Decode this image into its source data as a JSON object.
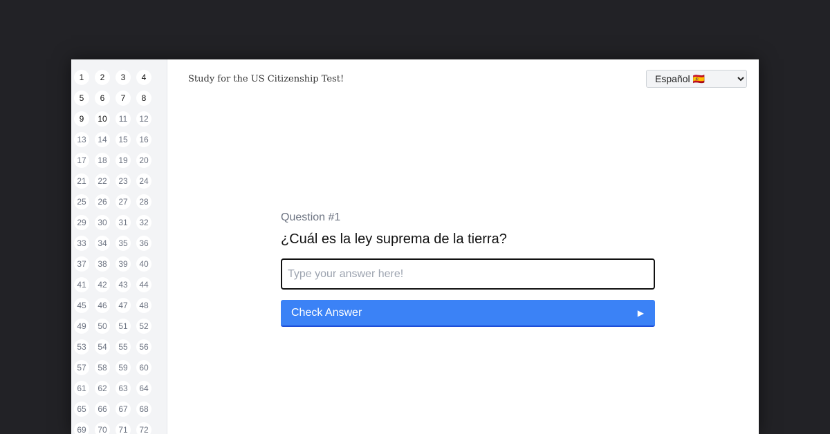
{
  "header": {
    "title": "Study for the US Citizenship Test!",
    "language_select": {
      "selected": "Español 🇪🇸",
      "options": [
        "Español 🇪🇸"
      ]
    }
  },
  "sidebar": {
    "questions": [
      {
        "label": "1",
        "done": true
      },
      {
        "label": "2",
        "done": true
      },
      {
        "label": "3",
        "done": true
      },
      {
        "label": "4",
        "done": true
      },
      {
        "label": "5",
        "done": true
      },
      {
        "label": "6",
        "done": true
      },
      {
        "label": "7",
        "done": true
      },
      {
        "label": "8",
        "done": true
      },
      {
        "label": "9",
        "done": true
      },
      {
        "label": "10",
        "done": true
      },
      {
        "label": "11",
        "done": false
      },
      {
        "label": "12",
        "done": false
      },
      {
        "label": "13",
        "done": false
      },
      {
        "label": "14",
        "done": false
      },
      {
        "label": "15",
        "done": false
      },
      {
        "label": "16",
        "done": false
      },
      {
        "label": "17",
        "done": false
      },
      {
        "label": "18",
        "done": false
      },
      {
        "label": "19",
        "done": false
      },
      {
        "label": "20",
        "done": false
      },
      {
        "label": "21",
        "done": false
      },
      {
        "label": "22",
        "done": false
      },
      {
        "label": "23",
        "done": false
      },
      {
        "label": "24",
        "done": false
      },
      {
        "label": "25",
        "done": false
      },
      {
        "label": "26",
        "done": false
      },
      {
        "label": "27",
        "done": false
      },
      {
        "label": "28",
        "done": false
      },
      {
        "label": "29",
        "done": false
      },
      {
        "label": "30",
        "done": false
      },
      {
        "label": "31",
        "done": false
      },
      {
        "label": "32",
        "done": false
      },
      {
        "label": "33",
        "done": false
      },
      {
        "label": "34",
        "done": false
      },
      {
        "label": "35",
        "done": false
      },
      {
        "label": "36",
        "done": false
      },
      {
        "label": "37",
        "done": false
      },
      {
        "label": "38",
        "done": false
      },
      {
        "label": "39",
        "done": false
      },
      {
        "label": "40",
        "done": false
      },
      {
        "label": "41",
        "done": false
      },
      {
        "label": "42",
        "done": false
      },
      {
        "label": "43",
        "done": false
      },
      {
        "label": "44",
        "done": false
      },
      {
        "label": "45",
        "done": false
      },
      {
        "label": "46",
        "done": false
      },
      {
        "label": "47",
        "done": false
      },
      {
        "label": "48",
        "done": false
      },
      {
        "label": "49",
        "done": false
      },
      {
        "label": "50",
        "done": false
      },
      {
        "label": "51",
        "done": false
      },
      {
        "label": "52",
        "done": false
      },
      {
        "label": "53",
        "done": false
      },
      {
        "label": "54",
        "done": false
      },
      {
        "label": "55",
        "done": false
      },
      {
        "label": "56",
        "done": false
      },
      {
        "label": "57",
        "done": false
      },
      {
        "label": "58",
        "done": false
      },
      {
        "label": "59",
        "done": false
      },
      {
        "label": "60",
        "done": false
      },
      {
        "label": "61",
        "done": false
      },
      {
        "label": "62",
        "done": false
      },
      {
        "label": "63",
        "done": false
      },
      {
        "label": "64",
        "done": false
      },
      {
        "label": "65",
        "done": false
      },
      {
        "label": "66",
        "done": false
      },
      {
        "label": "67",
        "done": false
      },
      {
        "label": "68",
        "done": false
      },
      {
        "label": "69",
        "done": false
      },
      {
        "label": "70",
        "done": false
      },
      {
        "label": "71",
        "done": false
      },
      {
        "label": "72",
        "done": false
      }
    ]
  },
  "question": {
    "number_label": "Question #1",
    "text": "¿Cuál es la ley suprema de la tierra?",
    "answer_value": "",
    "answer_placeholder": "Type your answer here!",
    "check_label": "Check Answer",
    "check_icon": "play-icon"
  },
  "colors": {
    "background": "#222226",
    "sidebar": "#f3f4f6",
    "accent": "#3b82f6"
  }
}
